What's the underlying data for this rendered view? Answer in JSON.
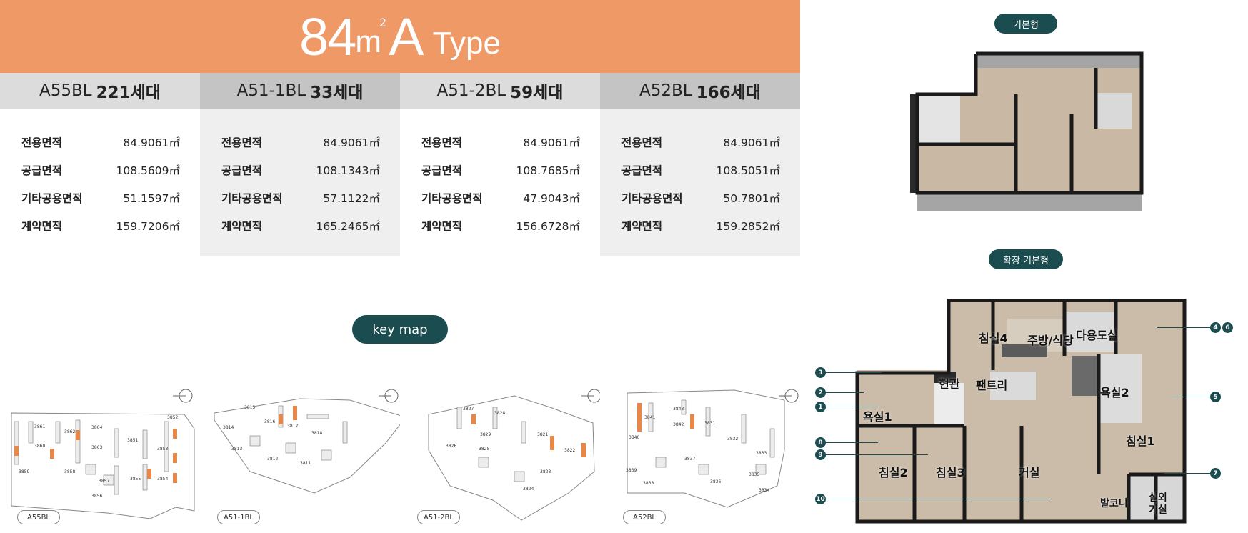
{
  "header": {
    "area_number": "84",
    "area_unit": "m",
    "area_sup": "2",
    "area_letter": "A",
    "type_label": "Type"
  },
  "blocks": [
    {
      "name": "A55BL",
      "households": "221세대",
      "rows": [
        {
          "label": "전용면적",
          "value": "84.9061㎡"
        },
        {
          "label": "공급면적",
          "value": "108.5609㎡"
        },
        {
          "label": "기타공용면적",
          "value": "51.1597㎡"
        },
        {
          "label": "계약면적",
          "value": "159.7206㎡"
        }
      ]
    },
    {
      "name": "A51-1BL",
      "households": "33세대",
      "rows": [
        {
          "label": "전용면적",
          "value": "84.9061㎡"
        },
        {
          "label": "공급면적",
          "value": "108.1343㎡"
        },
        {
          "label": "기타공용면적",
          "value": "57.1122㎡"
        },
        {
          "label": "계약면적",
          "value": "165.2465㎡"
        }
      ]
    },
    {
      "name": "A51-2BL",
      "households": "59세대",
      "rows": [
        {
          "label": "전용면적",
          "value": "84.9061㎡"
        },
        {
          "label": "공급면적",
          "value": "108.7685㎡"
        },
        {
          "label": "기타공용면적",
          "value": "47.9043㎡"
        },
        {
          "label": "계약면적",
          "value": "156.6728㎡"
        }
      ]
    },
    {
      "name": "A52BL",
      "households": "166세대",
      "rows": [
        {
          "label": "전용면적",
          "value": "84.9061㎡"
        },
        {
          "label": "공급면적",
          "value": "108.5051㎡"
        },
        {
          "label": "기타공용면적",
          "value": "50.7801㎡"
        },
        {
          "label": "계약면적",
          "value": "159.2852㎡"
        }
      ]
    }
  ],
  "keymap": {
    "button_label": "key map",
    "maps": [
      {
        "label": "A55BL",
        "buildings": [
          "3852",
          "3861",
          "3862",
          "3864",
          "3851",
          "3860",
          "3863",
          "3853",
          "3859",
          "3858",
          "3857",
          "3855",
          "3854",
          "3856"
        ]
      },
      {
        "label": "A51-1BL",
        "buildings": [
          "3815",
          "3816",
          "3812",
          "3814",
          "3818",
          "3813",
          "3812",
          "3811"
        ]
      },
      {
        "label": "A51-2BL",
        "buildings": [
          "3827",
          "3828",
          "3829",
          "3821",
          "3826",
          "3825",
          "3822",
          "3823",
          "3824"
        ]
      },
      {
        "label": "A52BL",
        "buildings": [
          "3841",
          "3843",
          "3842",
          "3831",
          "3840",
          "3832",
          "3833",
          "3837",
          "3839",
          "3836",
          "3835",
          "3838",
          "3834"
        ]
      }
    ]
  },
  "plans": {
    "basic_label": "기본형",
    "extended_label": "확장 기본형",
    "rooms": {
      "bed4": "침실4",
      "kitchen": "주방/식당",
      "multi": "다용도실",
      "entrance": "현관",
      "pantry": "팬트리",
      "bath1": "욕실1",
      "bath2": "욕실2",
      "bed1": "침실1",
      "bed2": "침실2",
      "bed3": "침실3",
      "living": "거실",
      "balcony": "발코니",
      "outdoor": "실외",
      "outdoor2": "기실"
    },
    "markers": [
      "3",
      "2",
      "1",
      "8",
      "9",
      "10",
      "4",
      "6",
      "5",
      "7"
    ]
  },
  "colors": {
    "accent": "#ee9966",
    "teal": "#1b4d50"
  }
}
